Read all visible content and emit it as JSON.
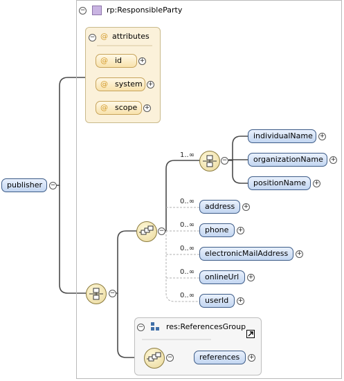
{
  "root": {
    "label": "publisher"
  },
  "rp_group": {
    "title": "rp:ResponsibleParty",
    "icon": "type-square-icon"
  },
  "attributes": {
    "header": "attributes",
    "items": [
      {
        "label": "id"
      },
      {
        "label": "system"
      },
      {
        "label": "scope"
      }
    ]
  },
  "choice_group": {
    "cardinality": "1..∞",
    "items": [
      {
        "label": "individualName"
      },
      {
        "label": "organizationName"
      },
      {
        "label": "positionName"
      }
    ]
  },
  "sequence": {
    "items": [
      {
        "cardinality": "0..∞",
        "label": "address"
      },
      {
        "cardinality": "0..∞",
        "label": "phone"
      },
      {
        "cardinality": "0..∞",
        "label": "electronicMailAddress"
      },
      {
        "cardinality": "0..∞",
        "label": "onlineUrl"
      },
      {
        "cardinality": "0..∞",
        "label": "userId"
      }
    ]
  },
  "references_group": {
    "title": "res:ReferencesGroup",
    "icon": "group-icon",
    "link_icon": "external-link-icon",
    "item": {
      "label": "references"
    }
  },
  "symbols": {
    "collapse": "−",
    "expand": "+",
    "at": "@"
  },
  "colors": {
    "element_fill": "#c3d6f1",
    "element_border": "#3b5a86",
    "attribute_fill": "#f8e2ac",
    "line": "#4a4a4a"
  }
}
